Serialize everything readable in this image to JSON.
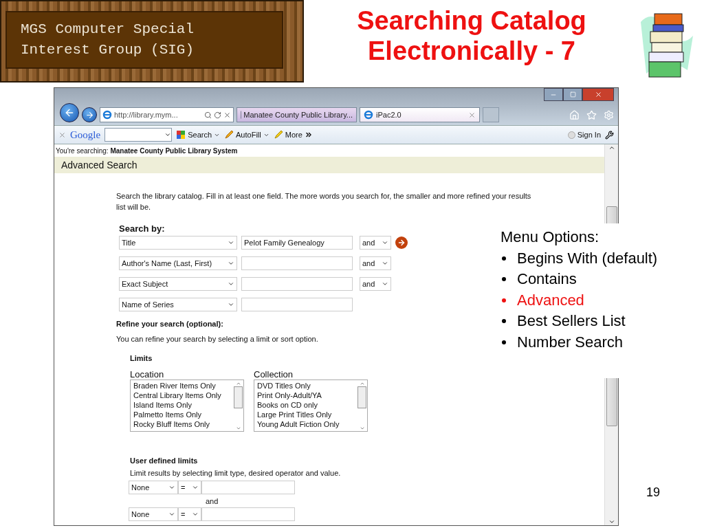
{
  "banner": {
    "lines": [
      "MGS Computer Special",
      "Interest Group (SIG)"
    ]
  },
  "title": {
    "lines": [
      "Searching Catalog",
      "Electronically - 7"
    ]
  },
  "browser": {
    "address": "http://library.mym...",
    "tabs": [
      {
        "label": "Manatee County Public Library...",
        "selected": false
      },
      {
        "label": "iPac2.0",
        "selected": true
      }
    ],
    "toolbar": {
      "brand": "Google",
      "items": [
        {
          "kind": "search",
          "label": "Search"
        },
        {
          "kind": "autofill",
          "label": "AutoFill"
        },
        {
          "kind": "more",
          "label": "More"
        }
      ],
      "sign_in": "Sign In"
    },
    "page": {
      "searching": "You're searching: **Manatee County Public Library System**",
      "heading": "Advanced Search",
      "intro": "Search the library catalog. Fill in at least one field. The more words you search for, the smaller and more refined your results list will be.",
      "search_by": "Search by:",
      "rows": [
        {
          "field": "Title",
          "value": "Pelot Family Genealogy",
          "operator": "and",
          "go": true
        },
        {
          "field": "Author's Name (Last, First)",
          "operator": "and",
          "go": false
        },
        {
          "field": "Exact Subject",
          "operator": "and",
          "go": false
        },
        {
          "field": "Name of Series",
          "go": false
        }
      ],
      "refine_heading": "Refine your search (optional):",
      "refine_text": "You can refine your search by selecting a limit or sort option.",
      "limits_heading": "Limits",
      "lists": [
        {
          "label": "Location",
          "items": [
            "Braden River Items Only",
            "Central Library Items Only",
            "Island Items Only",
            "Palmetto Items Only",
            "Rocky Bluff Items Only"
          ]
        },
        {
          "label": "Collection",
          "items": [
            "DVD Titles Only",
            "Print Only-Adult/YA",
            "Books on CD only",
            "Large Print Titles Only",
            "Young Adult Fiction Only"
          ]
        }
      ],
      "user_heading": "User defined limits",
      "user_text": "Limit results by selecting limit type, desired operator and value.",
      "user_rows": [
        {
          "type": "None",
          "operator": "="
        },
        {
          "type": "None",
          "operator": "="
        }
      ],
      "joiner": "and"
    }
  },
  "menu": {
    "title": "Menu Options:",
    "items": [
      {
        "label": "Begins With (default)",
        "color": "#000000"
      },
      {
        "label": "Contains",
        "color": "#000000"
      },
      {
        "label": "Advanced",
        "color": "#ee1111"
      },
      {
        "label": "Best Sellers List",
        "color": "#000000"
      },
      {
        "label": "Number Search",
        "color": "#000000"
      }
    ]
  },
  "page_number": "19"
}
